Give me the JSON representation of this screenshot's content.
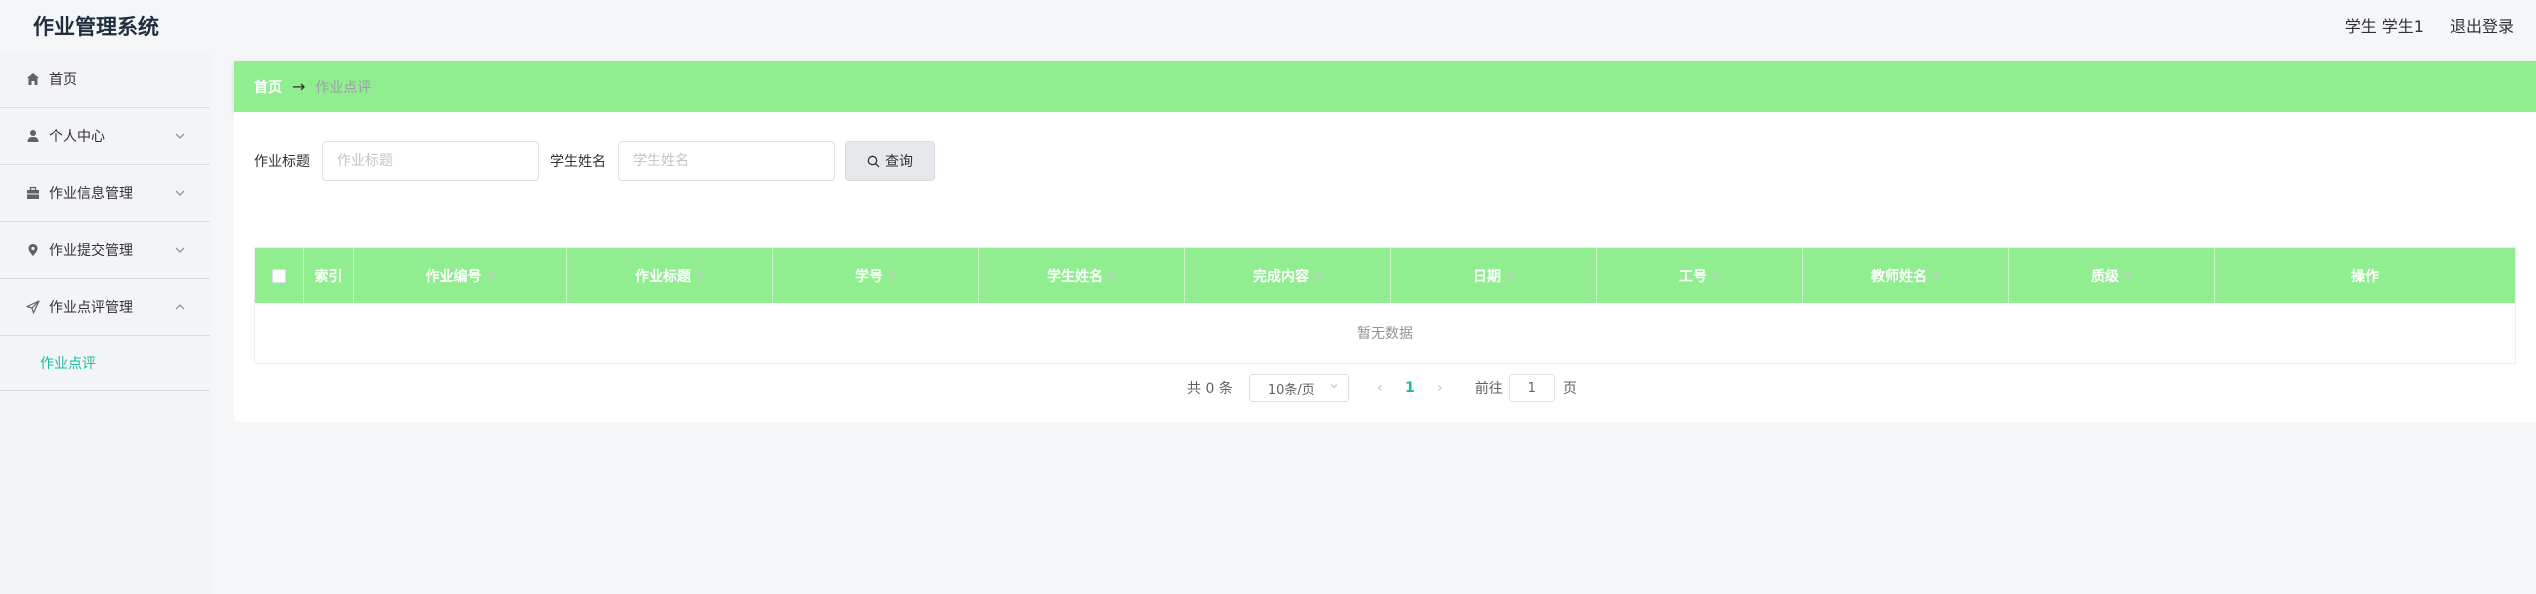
{
  "header": {
    "app_title": "作业管理系统",
    "user_info": "学生 学生1",
    "logout_label": "退出登录"
  },
  "sidebar": {
    "items": [
      {
        "label": "首页",
        "icon": "home-icon"
      },
      {
        "label": "个人中心",
        "icon": "user-icon"
      },
      {
        "label": "作业信息管理",
        "icon": "briefcase-icon"
      },
      {
        "label": "作业提交管理",
        "icon": "location-icon"
      },
      {
        "label": "作业点评管理",
        "icon": "send-icon"
      }
    ],
    "submenu_label": "作业点评"
  },
  "breadcrumb": {
    "home": "首页",
    "separator": "→",
    "current": "作业点评"
  },
  "search": {
    "title_label": "作业标题",
    "title_placeholder": "作业标题",
    "name_label": "学生姓名",
    "name_placeholder": "学生姓名",
    "button_label": "查询"
  },
  "table": {
    "columns": [
      "索引",
      "作业编号",
      "作业标题",
      "学号",
      "学生姓名",
      "完成内容",
      "日期",
      "工号",
      "教师姓名",
      "质级",
      "操作"
    ],
    "empty_text": "暂无数据"
  },
  "pagination": {
    "total_text": "共 0 条",
    "page_size": "10条/页",
    "prev": "‹",
    "current_page": "1",
    "next": "›",
    "goto_label": "前往",
    "goto_value": "1",
    "page_suffix": "页"
  },
  "colors": {
    "accent_green": "#90ee90",
    "active_teal": "#1abc9c"
  }
}
